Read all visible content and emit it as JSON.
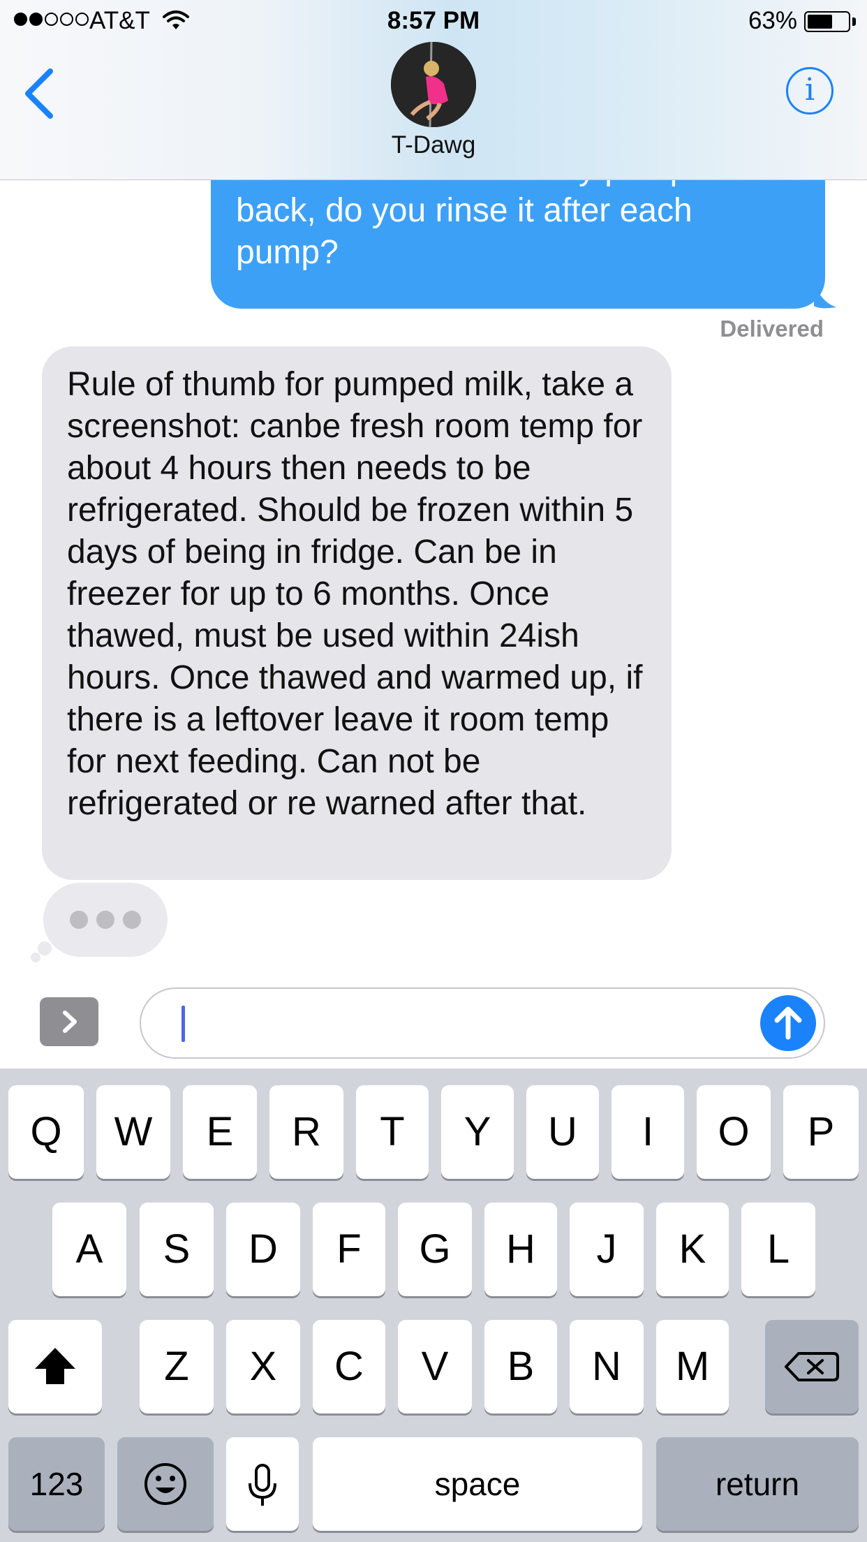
{
  "status_bar": {
    "carrier": "AT&T",
    "time": "8:57 PM",
    "battery_percent": "63%",
    "signal_bars_filled": 2,
    "signal_bars_total": 5,
    "battery_level": 0.63
  },
  "header": {
    "contact_name": "T-Dawg",
    "back_icon": "chevron-left-icon",
    "info_icon": "info-icon",
    "info_glyph": "i"
  },
  "messages": {
    "outgoing": {
      "text": "And then I can leave my pump in the back, do you rinse it after each pump?",
      "status": "Delivered"
    },
    "incoming": {
      "text": "Rule of thumb for pumped milk, take a screenshot: canbe fresh room temp for about 4 hours then needs to be refrigerated. Should be frozen within 5 days of being in fridge. Can be in freezer for up to 6 months. Once thawed, must be used within 24ish hours. Once thawed and warmed up, if there is a leftover leave it room temp for next feeding. Can not be refrigerated or re warned after that."
    },
    "typing_indicator": true
  },
  "compose": {
    "value": "",
    "placeholder": "",
    "send_icon": "arrow-up-icon",
    "expand_icon": "chevron-right-icon"
  },
  "keyboard": {
    "row1": [
      "Q",
      "W",
      "E",
      "R",
      "T",
      "Y",
      "U",
      "I",
      "O",
      "P"
    ],
    "row2": [
      "A",
      "S",
      "D",
      "F",
      "G",
      "H",
      "J",
      "K",
      "L"
    ],
    "row3": [
      "Z",
      "X",
      "C",
      "V",
      "B",
      "N",
      "M"
    ],
    "numbers_label": "123",
    "space_label": "space",
    "return_label": "return",
    "shift_icon": "shift-icon",
    "delete_icon": "delete-icon",
    "emoji_icon": "emoji-icon",
    "mic_icon": "microphone-icon"
  },
  "colors": {
    "accent": "#1a82fb",
    "outgoing_bubble": "#3da0f7",
    "incoming_bubble": "#e5e5ea",
    "keyboard_background": "#d1d5db"
  }
}
